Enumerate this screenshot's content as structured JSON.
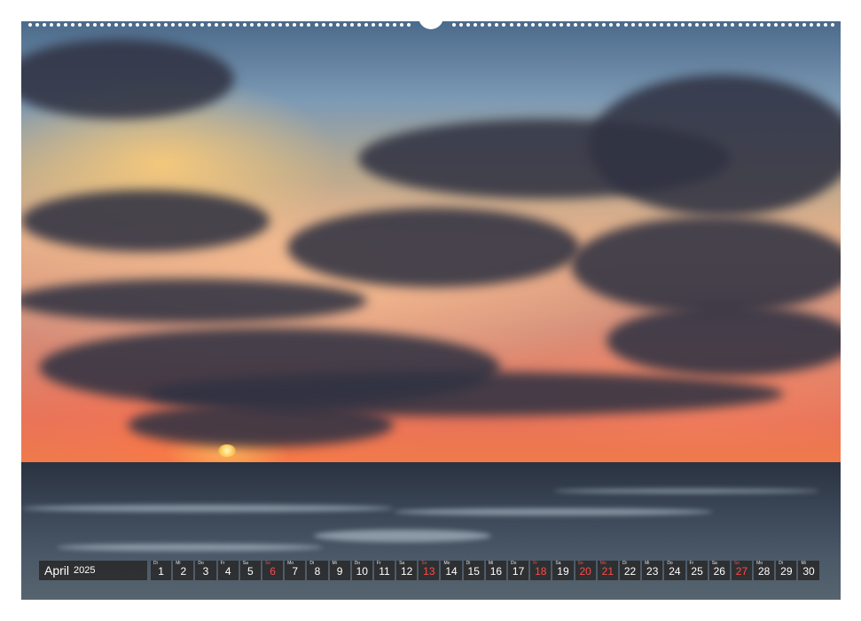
{
  "calendar": {
    "month": "April",
    "year": "2025",
    "days": [
      {
        "wd": "Di",
        "d": "1",
        "red": false
      },
      {
        "wd": "Mi",
        "d": "2",
        "red": false
      },
      {
        "wd": "Do",
        "d": "3",
        "red": false
      },
      {
        "wd": "Fr",
        "d": "4",
        "red": false
      },
      {
        "wd": "Sa",
        "d": "5",
        "red": false
      },
      {
        "wd": "So",
        "d": "6",
        "red": true
      },
      {
        "wd": "Mo",
        "d": "7",
        "red": false
      },
      {
        "wd": "Di",
        "d": "8",
        "red": false
      },
      {
        "wd": "Mi",
        "d": "9",
        "red": false
      },
      {
        "wd": "Do",
        "d": "10",
        "red": false
      },
      {
        "wd": "Fr",
        "d": "11",
        "red": false
      },
      {
        "wd": "Sa",
        "d": "12",
        "red": false
      },
      {
        "wd": "So",
        "d": "13",
        "red": true
      },
      {
        "wd": "Mo",
        "d": "14",
        "red": false
      },
      {
        "wd": "Di",
        "d": "15",
        "red": false
      },
      {
        "wd": "Mi",
        "d": "16",
        "red": false
      },
      {
        "wd": "Do",
        "d": "17",
        "red": false
      },
      {
        "wd": "Fr",
        "d": "18",
        "red": true
      },
      {
        "wd": "Sa",
        "d": "19",
        "red": false
      },
      {
        "wd": "So",
        "d": "20",
        "red": true
      },
      {
        "wd": "Mo",
        "d": "21",
        "red": true
      },
      {
        "wd": "Di",
        "d": "22",
        "red": false
      },
      {
        "wd": "Mi",
        "d": "23",
        "red": false
      },
      {
        "wd": "Do",
        "d": "24",
        "red": false
      },
      {
        "wd": "Fr",
        "d": "25",
        "red": false
      },
      {
        "wd": "Sa",
        "d": "26",
        "red": false
      },
      {
        "wd": "So",
        "d": "27",
        "red": true
      },
      {
        "wd": "Mo",
        "d": "28",
        "red": false
      },
      {
        "wd": "Di",
        "d": "29",
        "red": false
      },
      {
        "wd": "Mi",
        "d": "30",
        "red": false
      }
    ]
  },
  "colors": {
    "holiday_red": "#ff4a4a",
    "strip_background": "#282828"
  },
  "image": {
    "subject": "sunset-over-sea-photo"
  }
}
